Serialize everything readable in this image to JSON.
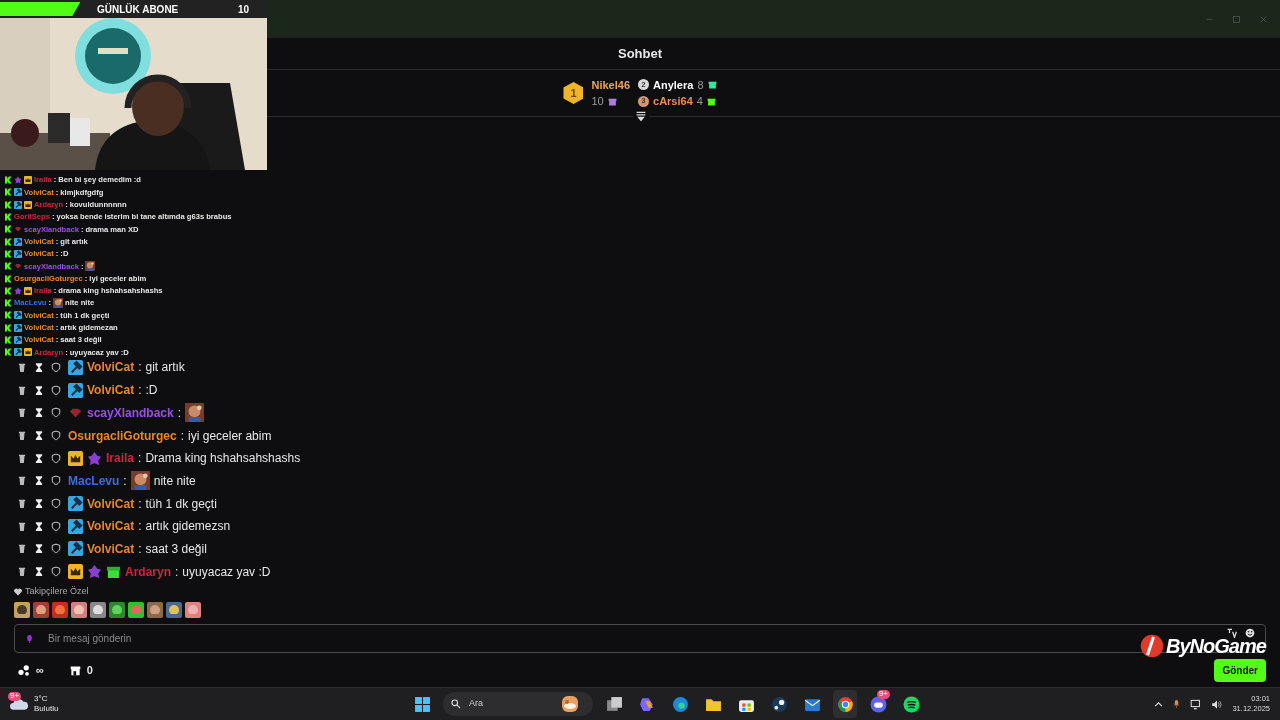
{
  "stream_overlay": {
    "goal_label": "GÜNLÜK ABONE",
    "goal_count": "10",
    "level": 0.3,
    "webcam": {
      "kind": "picture"
    },
    "chat": [
      {
        "user": "Iraila",
        "color": "#c8283c",
        "badges": [
          {
            "kind": "kick"
          },
          {
            "kind": "gem"
          },
          {
            "kind": "crown"
          }
        ],
        "separator": ":",
        "text": "Ben bi şey demedim :d"
      },
      {
        "user": "VolviCat",
        "color": "#e8862a",
        "badges": [
          {
            "kind": "kick"
          },
          {
            "kind": "mod"
          }
        ],
        "separator": ":",
        "text": "klmjkdfgdfg"
      },
      {
        "user": "Ardaryn",
        "color": "#c8283c",
        "badges": [
          {
            "kind": "kick"
          },
          {
            "kind": "mod"
          },
          {
            "kind": "crown"
          }
        ],
        "separator": ":",
        "text": "kovuldunnnnnn"
      },
      {
        "user": "GorilSeps",
        "color": "#c8283c",
        "badges": [
          {
            "kind": "kick"
          }
        ],
        "separator": ":",
        "text": "yoksa bende isterim bi tane altımda g63s brabus"
      },
      {
        "user": "scayXlandback",
        "color": "#9b4fe0",
        "badges": [
          {
            "kind": "kick"
          },
          {
            "kind": "redgem"
          }
        ],
        "separator": ":",
        "text": "drama man XD"
      },
      {
        "user": "VolviCat",
        "color": "#e8862a",
        "badges": [
          {
            "kind": "kick"
          },
          {
            "kind": "mod"
          }
        ],
        "separator": ":",
        "text": "git artık"
      },
      {
        "user": "VolviCat",
        "color": "#e8862a",
        "badges": [
          {
            "kind": "kick"
          },
          {
            "kind": "mod"
          }
        ],
        "separator": ":",
        "text": ":D"
      },
      {
        "user": "scayXlandback",
        "color": "#9b4fe0",
        "badges": [
          {
            "kind": "kick"
          },
          {
            "kind": "redgem"
          }
        ],
        "separator": ":",
        "emote": {
          "kind": "picture"
        }
      },
      {
        "user": "OsurgacliGoturgec",
        "color": "#e8862a",
        "badges": [
          {
            "kind": "kick"
          }
        ],
        "separator": ":",
        "text": "iyi geceler abim"
      },
      {
        "user": "Iraila",
        "color": "#c8283c",
        "badges": [
          {
            "kind": "kick"
          },
          {
            "kind": "gem"
          },
          {
            "kind": "crown"
          }
        ],
        "separator": ":",
        "text": "drama king hshahsahshashs"
      },
      {
        "user": "MacLevu",
        "color": "#3a6ee0",
        "badges": [
          {
            "kind": "kick"
          }
        ],
        "separator": ":",
        "emote": {
          "kind": "picture"
        },
        "text": "nite nite"
      },
      {
        "user": "VolviCat",
        "color": "#e8862a",
        "badges": [
          {
            "kind": "kick"
          },
          {
            "kind": "mod"
          }
        ],
        "separator": ":",
        "text": "tüh 1 dk geçti"
      },
      {
        "user": "VolviCat",
        "color": "#e8862a",
        "badges": [
          {
            "kind": "kick"
          },
          {
            "kind": "mod"
          }
        ],
        "separator": ":",
        "text": "artık gidemezan"
      },
      {
        "user": "VolviCat",
        "color": "#e8862a",
        "badges": [
          {
            "kind": "kick"
          },
          {
            "kind": "mod"
          }
        ],
        "separator": ":",
        "text": "saat 3 değil"
      },
      {
        "user": "Ardaryn",
        "color": "#c8283c",
        "badges": [
          {
            "kind": "kick"
          },
          {
            "kind": "mod"
          },
          {
            "kind": "crown"
          }
        ],
        "separator": ":",
        "text": "uyuyacaz yav :D"
      }
    ]
  },
  "chat": {
    "title": "Sohbet",
    "leaderboard": [
      {
        "rank": "1",
        "name": "Nikel46",
        "count": "10",
        "color": "#b07ae8"
      },
      {
        "rank": "2",
        "name": "Anylera",
        "count": "8",
        "color": "#2ee8a0"
      },
      {
        "rank": "3",
        "name": "cArsi64",
        "count": "4",
        "color": "#53fc18"
      }
    ],
    "messages": [
      {
        "user": "VolviCat",
        "color": "#e8862a",
        "badges": [
          {
            "kind": "mod"
          }
        ],
        "separator": ":",
        "text": "git artık"
      },
      {
        "user": "VolviCat",
        "color": "#e8862a",
        "badges": [
          {
            "kind": "mod"
          }
        ],
        "separator": ":",
        "text": ":D"
      },
      {
        "user": "scayXlandback",
        "color": "#9b4fe0",
        "badges": [
          {
            "kind": "redgem"
          }
        ],
        "separator": ":",
        "emote": {
          "kind": "picture"
        }
      },
      {
        "user": "OsurgacliGoturgec",
        "color": "#e8862a",
        "separator": ":",
        "text": "iyi geceler abim"
      },
      {
        "user": "Iraila",
        "color": "#c8283c",
        "badges": [
          {
            "kind": "crown"
          },
          {
            "kind": "gem"
          }
        ],
        "separator": ":",
        "text": "Drama king hshahsahshashs"
      },
      {
        "user": "MacLevu",
        "color": "#3a6ee0",
        "separator": ":",
        "emote": {
          "kind": "picture"
        },
        "text": "nite nite"
      },
      {
        "user": "VolviCat",
        "color": "#e8862a",
        "badges": [
          {
            "kind": "mod"
          }
        ],
        "separator": ":",
        "text": "tüh 1 dk geçti"
      },
      {
        "user": "VolviCat",
        "color": "#e8862a",
        "badges": [
          {
            "kind": "mod"
          }
        ],
        "separator": ":",
        "text": "artık gidemezsn"
      },
      {
        "user": "VolviCat",
        "color": "#e8862a",
        "badges": [
          {
            "kind": "mod"
          }
        ],
        "separator": ":",
        "text": "saat 3 değil"
      },
      {
        "user": "Ardaryn",
        "color": "#c8283c",
        "badges": [
          {
            "kind": "crown"
          },
          {
            "kind": "gem"
          },
          {
            "kind": "gift"
          }
        ],
        "separator": ":",
        "text": "uyuyacaz yav :D"
      }
    ],
    "emote_section": {
      "label": "Takipçilere Özel",
      "emotes": [
        {
          "kind": "picture"
        },
        {
          "kind": "picture"
        },
        {
          "kind": "picture"
        },
        {
          "kind": "picture"
        },
        {
          "kind": "picture"
        },
        {
          "kind": "picture"
        },
        {
          "kind": "picture"
        },
        {
          "kind": "picture"
        },
        {
          "kind": "picture"
        },
        {
          "kind": "picture"
        }
      ]
    },
    "input": {
      "placeholder": "Bir mesaj gönderin"
    },
    "points": "∞",
    "store_count": "0",
    "send_button": "Gönder"
  },
  "stream_logo": "ByNoGame",
  "taskbar": {
    "weather": {
      "badge": "9+",
      "temperature": "3°C",
      "condition": "Bulutlu"
    },
    "search": {
      "placeholder": "Ara"
    },
    "apps": [
      {
        "kind": "taskview",
        "active": false
      },
      {
        "kind": "copilot",
        "active": false
      },
      {
        "kind": "edge",
        "active": false
      },
      {
        "kind": "folder",
        "active": false
      },
      {
        "kind": "store",
        "active": false
      },
      {
        "kind": "steam",
        "active": false
      },
      {
        "kind": "mail",
        "active": false
      },
      {
        "kind": "chrome",
        "active": true
      },
      {
        "kind": "discord",
        "active": false,
        "badge": "9+"
      },
      {
        "kind": "spotify",
        "active": false
      }
    ],
    "time": "03:01",
    "date": "31.12.2025"
  }
}
